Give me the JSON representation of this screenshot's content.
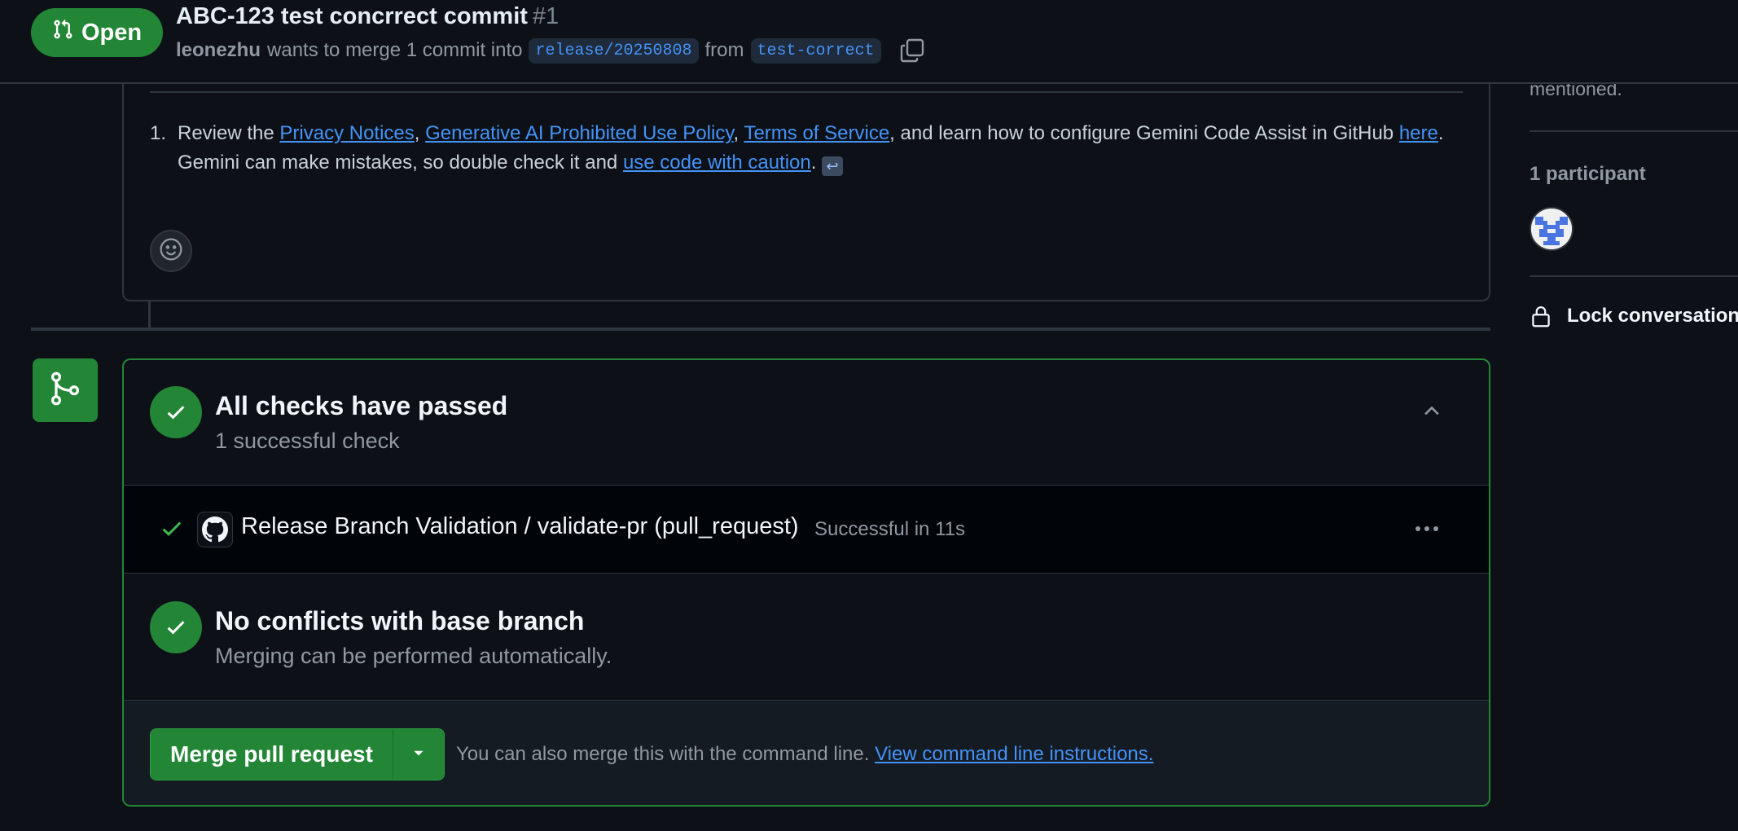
{
  "header": {
    "state": "Open",
    "title": "ABC-123 test concrrect commit",
    "number": "#1",
    "author": "leonezhu",
    "meta_text": "wants to merge 1 commit into",
    "base_branch": "release/20250808",
    "from_text": "from",
    "head_branch": "test-correct"
  },
  "comment": {
    "item_number": "1.",
    "text_review": "Review the",
    "link_privacy": "Privacy Notices",
    "comma1": ",",
    "link_ai_policy": "Generative AI Prohibited Use Policy",
    "comma2": ",",
    "link_tos": "Terms of Service",
    "text_learn": ", and learn how to configure Gemini Code Assist in GitHub",
    "link_here": "here",
    "text_mistakes": ". Gemini can make mistakes, so double check it and",
    "link_caution": "use code with caution",
    "period": ".",
    "return_glyph": "↩"
  },
  "checks": {
    "title": "All checks have passed",
    "subtitle": "1 successful check",
    "run_name": "Release Branch Validation / validate-pr (pull_request)",
    "run_status": "Successful in 11s"
  },
  "conflicts": {
    "title": "No conflicts with base branch",
    "subtitle": "Merging can be performed automatically."
  },
  "merge": {
    "button_label": "Merge pull request",
    "hint_text": "You can also merge this with the command line.",
    "hint_link": "View command line instructions."
  },
  "sidebar": {
    "mentioned_text": "mentioned.",
    "participants_heading": "1 participant",
    "lock_label": "Lock conversation"
  },
  "colors": {
    "background": "#0d1117",
    "success": "#238636",
    "link": "#4493f8",
    "border": "#30363d"
  },
  "icons": [
    "git-pull-request-icon",
    "copy-icon",
    "smiley-icon",
    "git-merge-icon",
    "check-icon",
    "chevron-up-icon",
    "github-icon",
    "kebab-icon",
    "triangle-down-icon",
    "lock-icon"
  ]
}
